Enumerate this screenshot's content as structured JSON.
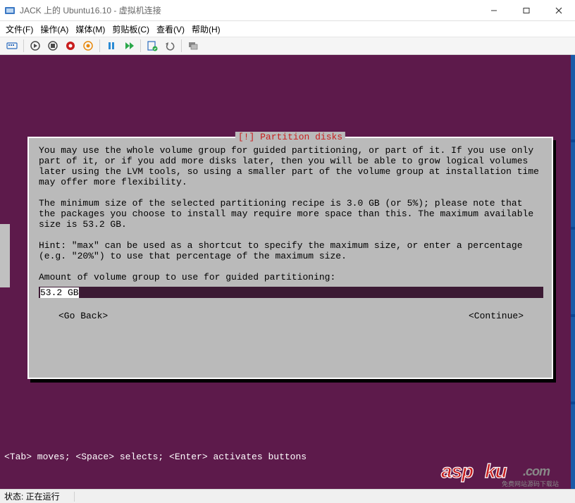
{
  "window": {
    "title": "JACK 上的 Ubuntu16.10 - 虚拟机连接"
  },
  "menu": {
    "file": "文件(F)",
    "action": "操作(A)",
    "media": "媒体(M)",
    "clipboard": "剪贴板(C)",
    "view": "查看(V)",
    "help": "帮助(H)"
  },
  "installer": {
    "dialog_title": "[!] Partition disks",
    "paragraph1": "You may use the whole volume group for guided partitioning, or part of it. If you use only part of it, or if you add more disks later, then you will be able to grow logical volumes later using the LVM tools, so using a smaller part of the volume group at installation time may offer more flexibility.",
    "paragraph2": "The minimum size of the selected partitioning recipe is 3.0 GB (or 5%); please note that the packages you choose to install may require more space than this. The maximum available size is 53.2 GB.",
    "paragraph3": "Hint: \"max\" can be used as a shortcut to specify the maximum size, or enter a percentage (e.g. \"20%\") to use that percentage of the maximum size.",
    "prompt": "Amount of volume group to use for guided partitioning:",
    "input_value": "53.2 GB",
    "go_back": "<Go Back>",
    "continue": "<Continue>",
    "footer_hint": "<Tab> moves; <Space> selects; <Enter> activates buttons"
  },
  "status": {
    "label": "状态: 正在运行"
  },
  "watermark": {
    "main1": "asp",
    "main2": "ku",
    "dotcom": ".com",
    "sub": "免费网站源码下载站"
  }
}
